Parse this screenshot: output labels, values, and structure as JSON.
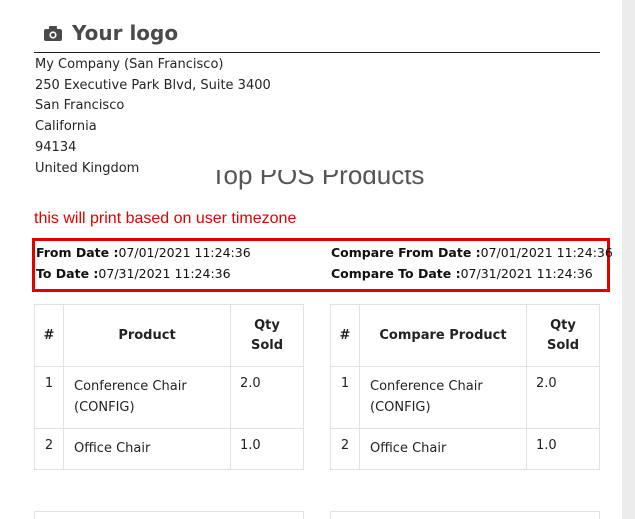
{
  "logo": {
    "text": "Your logo",
    "icon": "camera-icon"
  },
  "company": {
    "lines": [
      "My Company (San Francisco)",
      "250 Executive Park Blvd, Suite 3400",
      "San Francisco",
      "California",
      "94134",
      "United Kingdom"
    ]
  },
  "report": {
    "title": "Top POS Products"
  },
  "note": "this will print based on user timezone",
  "dates": {
    "from_label": "From Date :",
    "from_value": "07/01/2021 11:24:36",
    "to_label": "To Date :",
    "to_value": "07/31/2021 11:24:36",
    "compare_from_label": "Compare From Date :",
    "compare_from_value": "07/01/2021 11:24:36",
    "compare_to_label": "Compare To Date :",
    "compare_to_value": "07/31/2021 11:24:36"
  },
  "table_left": {
    "headers": {
      "idx": "#",
      "product": "Product",
      "qty_line1": "Qty",
      "qty_line2": "Sold"
    },
    "rows": [
      {
        "idx": "1",
        "product_line1": "Conference Chair",
        "product_line2": "(CONFIG)",
        "qty": "2.0"
      },
      {
        "idx": "2",
        "product_line1": "Office Chair",
        "product_line2": "",
        "qty": "1.0"
      }
    ]
  },
  "table_right": {
    "headers": {
      "idx": "#",
      "product": "Compare Product",
      "qty_line1": "Qty",
      "qty_line2": "Sold"
    },
    "rows": [
      {
        "idx": "1",
        "product_line1": "Conference Chair",
        "product_line2": "(CONFIG)",
        "qty": "2.0"
      },
      {
        "idx": "2",
        "product_line1": "Office Chair",
        "product_line2": "",
        "qty": "1.0"
      }
    ]
  }
}
